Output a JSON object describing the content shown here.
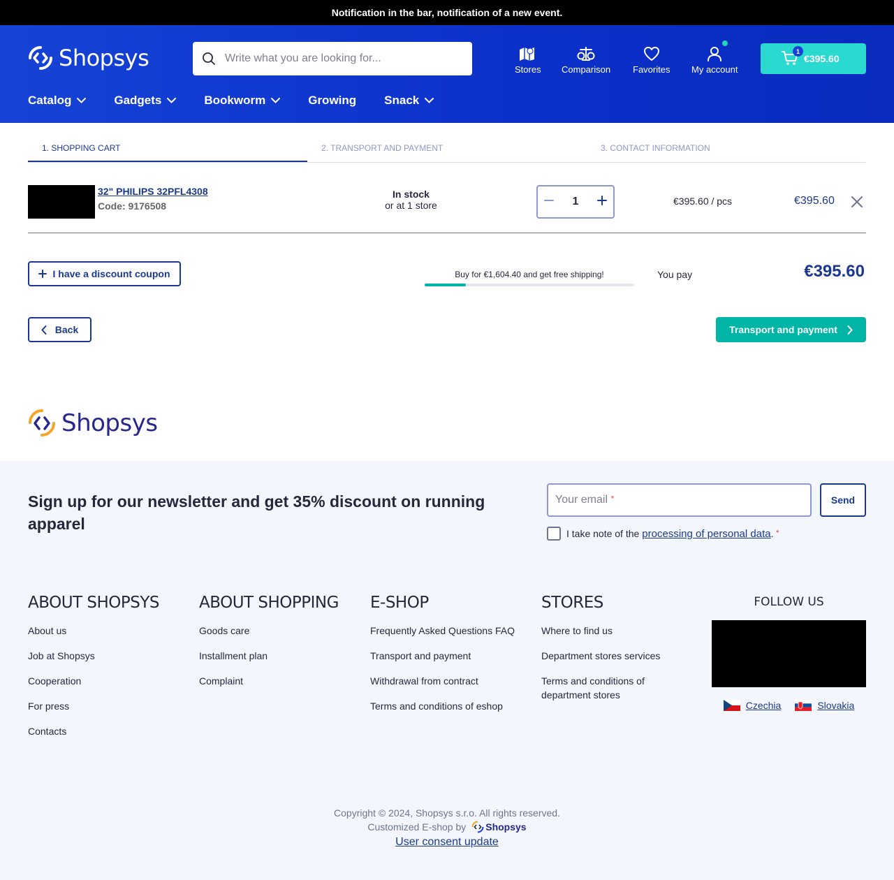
{
  "notification": "Notification in the bar, notification of a new event.",
  "header": {
    "logo_text": "Shopsys",
    "search_placeholder": "Write what you are looking for...",
    "nav": {
      "stores": "Stores",
      "comparison": "Comparison",
      "favorites": "Favorites",
      "account": "My account"
    },
    "cart": {
      "count": "1",
      "total": "€395.60"
    },
    "categories": [
      "Catalog",
      "Gadgets",
      "Bookworm",
      "Growing",
      "Snack"
    ]
  },
  "steps": [
    "1. SHOPPING CART",
    "2. TRANSPORT AND PAYMENT",
    "3. CONTACT INFORMATION"
  ],
  "cart_item": {
    "name": "32\" PHILIPS 32PFL4308",
    "code": "Code: 9176508",
    "stock": "In stock",
    "stores": "or at 1 store",
    "quantity": "1",
    "unit_price": "€395.60 / pcs",
    "total": "€395.60"
  },
  "summary": {
    "coupon": "I have a discount coupon",
    "free_shipping": "Buy for €1,604.40 and get free shipping!",
    "free_shipping_progress": 0.197,
    "you_pay_label": "You pay",
    "you_pay": "€395.60",
    "back": "Back",
    "next": "Transport and payment"
  },
  "footer": {
    "logo_text": "Shopsys",
    "newsletter_title": "Sign up for our newsletter and get 35% discount on running apparel",
    "email_placeholder": "Your email",
    "send": "Send",
    "consent_prefix": "I take note of the",
    "consent_link": "processing of personal data",
    "columns": [
      {
        "title": "ABOUT SHOPSYS",
        "links": [
          "About us",
          "Job at Shopsys",
          "Cooperation",
          "For press",
          "Contacts"
        ]
      },
      {
        "title": "ABOUT SHOPPING",
        "links": [
          "Goods care",
          "Installment plan",
          "Complaint"
        ]
      },
      {
        "title": "E-SHOP",
        "links": [
          "Frequently Asked Questions FAQ",
          "Transport and payment",
          "Withdrawal from contract",
          "Terms and conditions of eshop"
        ]
      },
      {
        "title": "STORES",
        "links": [
          "Where to find us",
          "Department stores services",
          "Terms and conditions of department stores"
        ]
      }
    ],
    "follow_us": "FOLLOW US",
    "countries": [
      "Czechia",
      "Slovakia"
    ],
    "copyright": "Copyright © 2024, Shopsys s.r.o. All rights reserved.",
    "customized": "Customized E-shop by",
    "customized_logo": "Shopsys",
    "consent_update": "User consent update"
  },
  "colors": {
    "brand_blue": "#1643d6",
    "dark_blue": "#1b3a8f",
    "accent_teal": "#00b4a6",
    "cart_teal": "#2ad9d0"
  }
}
